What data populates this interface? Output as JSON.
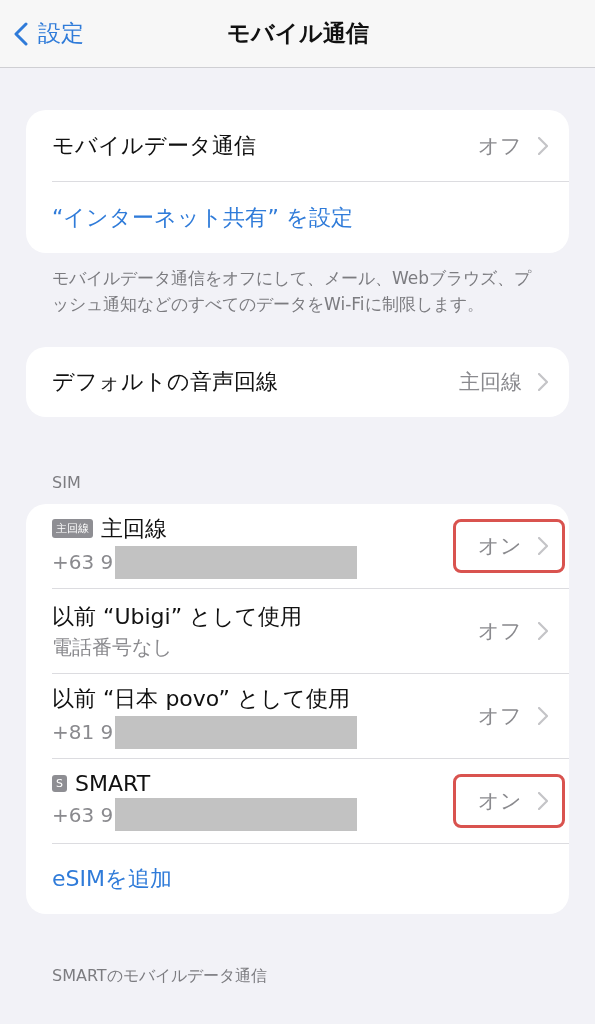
{
  "nav": {
    "back": "設定",
    "title": "モバイル通信"
  },
  "data_group": {
    "rows": [
      {
        "kind": "value",
        "label": "モバイルデータ通信",
        "value": "オフ"
      },
      {
        "kind": "link",
        "label": "“インターネット共有” を設定"
      }
    ],
    "footer": "モバイルデータ通信をオフにして、メール、Webブラウズ、プッシュ通知などのすべてのデータをWi-Fiに制限します。"
  },
  "voice_group": {
    "rows": [
      {
        "kind": "value",
        "label": "デフォルトの音声回線",
        "value": "主回線"
      }
    ]
  },
  "sim_section": {
    "header": "SIM",
    "items": [
      {
        "badge": "主回線",
        "label": "主回線",
        "subtitle": "+63 9",
        "redacted": true,
        "value": "オン",
        "highlighted": true
      },
      {
        "label": "以前 “Ubigi” として使用",
        "subtitle": "電話番号なし",
        "redacted": false,
        "value": "オフ",
        "highlighted": false
      },
      {
        "label": "以前 “日本 povo” として使用",
        "subtitle": "+81 9",
        "redacted": true,
        "value": "オフ",
        "highlighted": false
      },
      {
        "badge": "S",
        "label": "SMART",
        "subtitle": "+63 9",
        "redacted": true,
        "value": "オン",
        "highlighted": true
      }
    ],
    "add_link": "eSIMを追加"
  },
  "next_section_header": "SMARTのモバイルデータ通信"
}
